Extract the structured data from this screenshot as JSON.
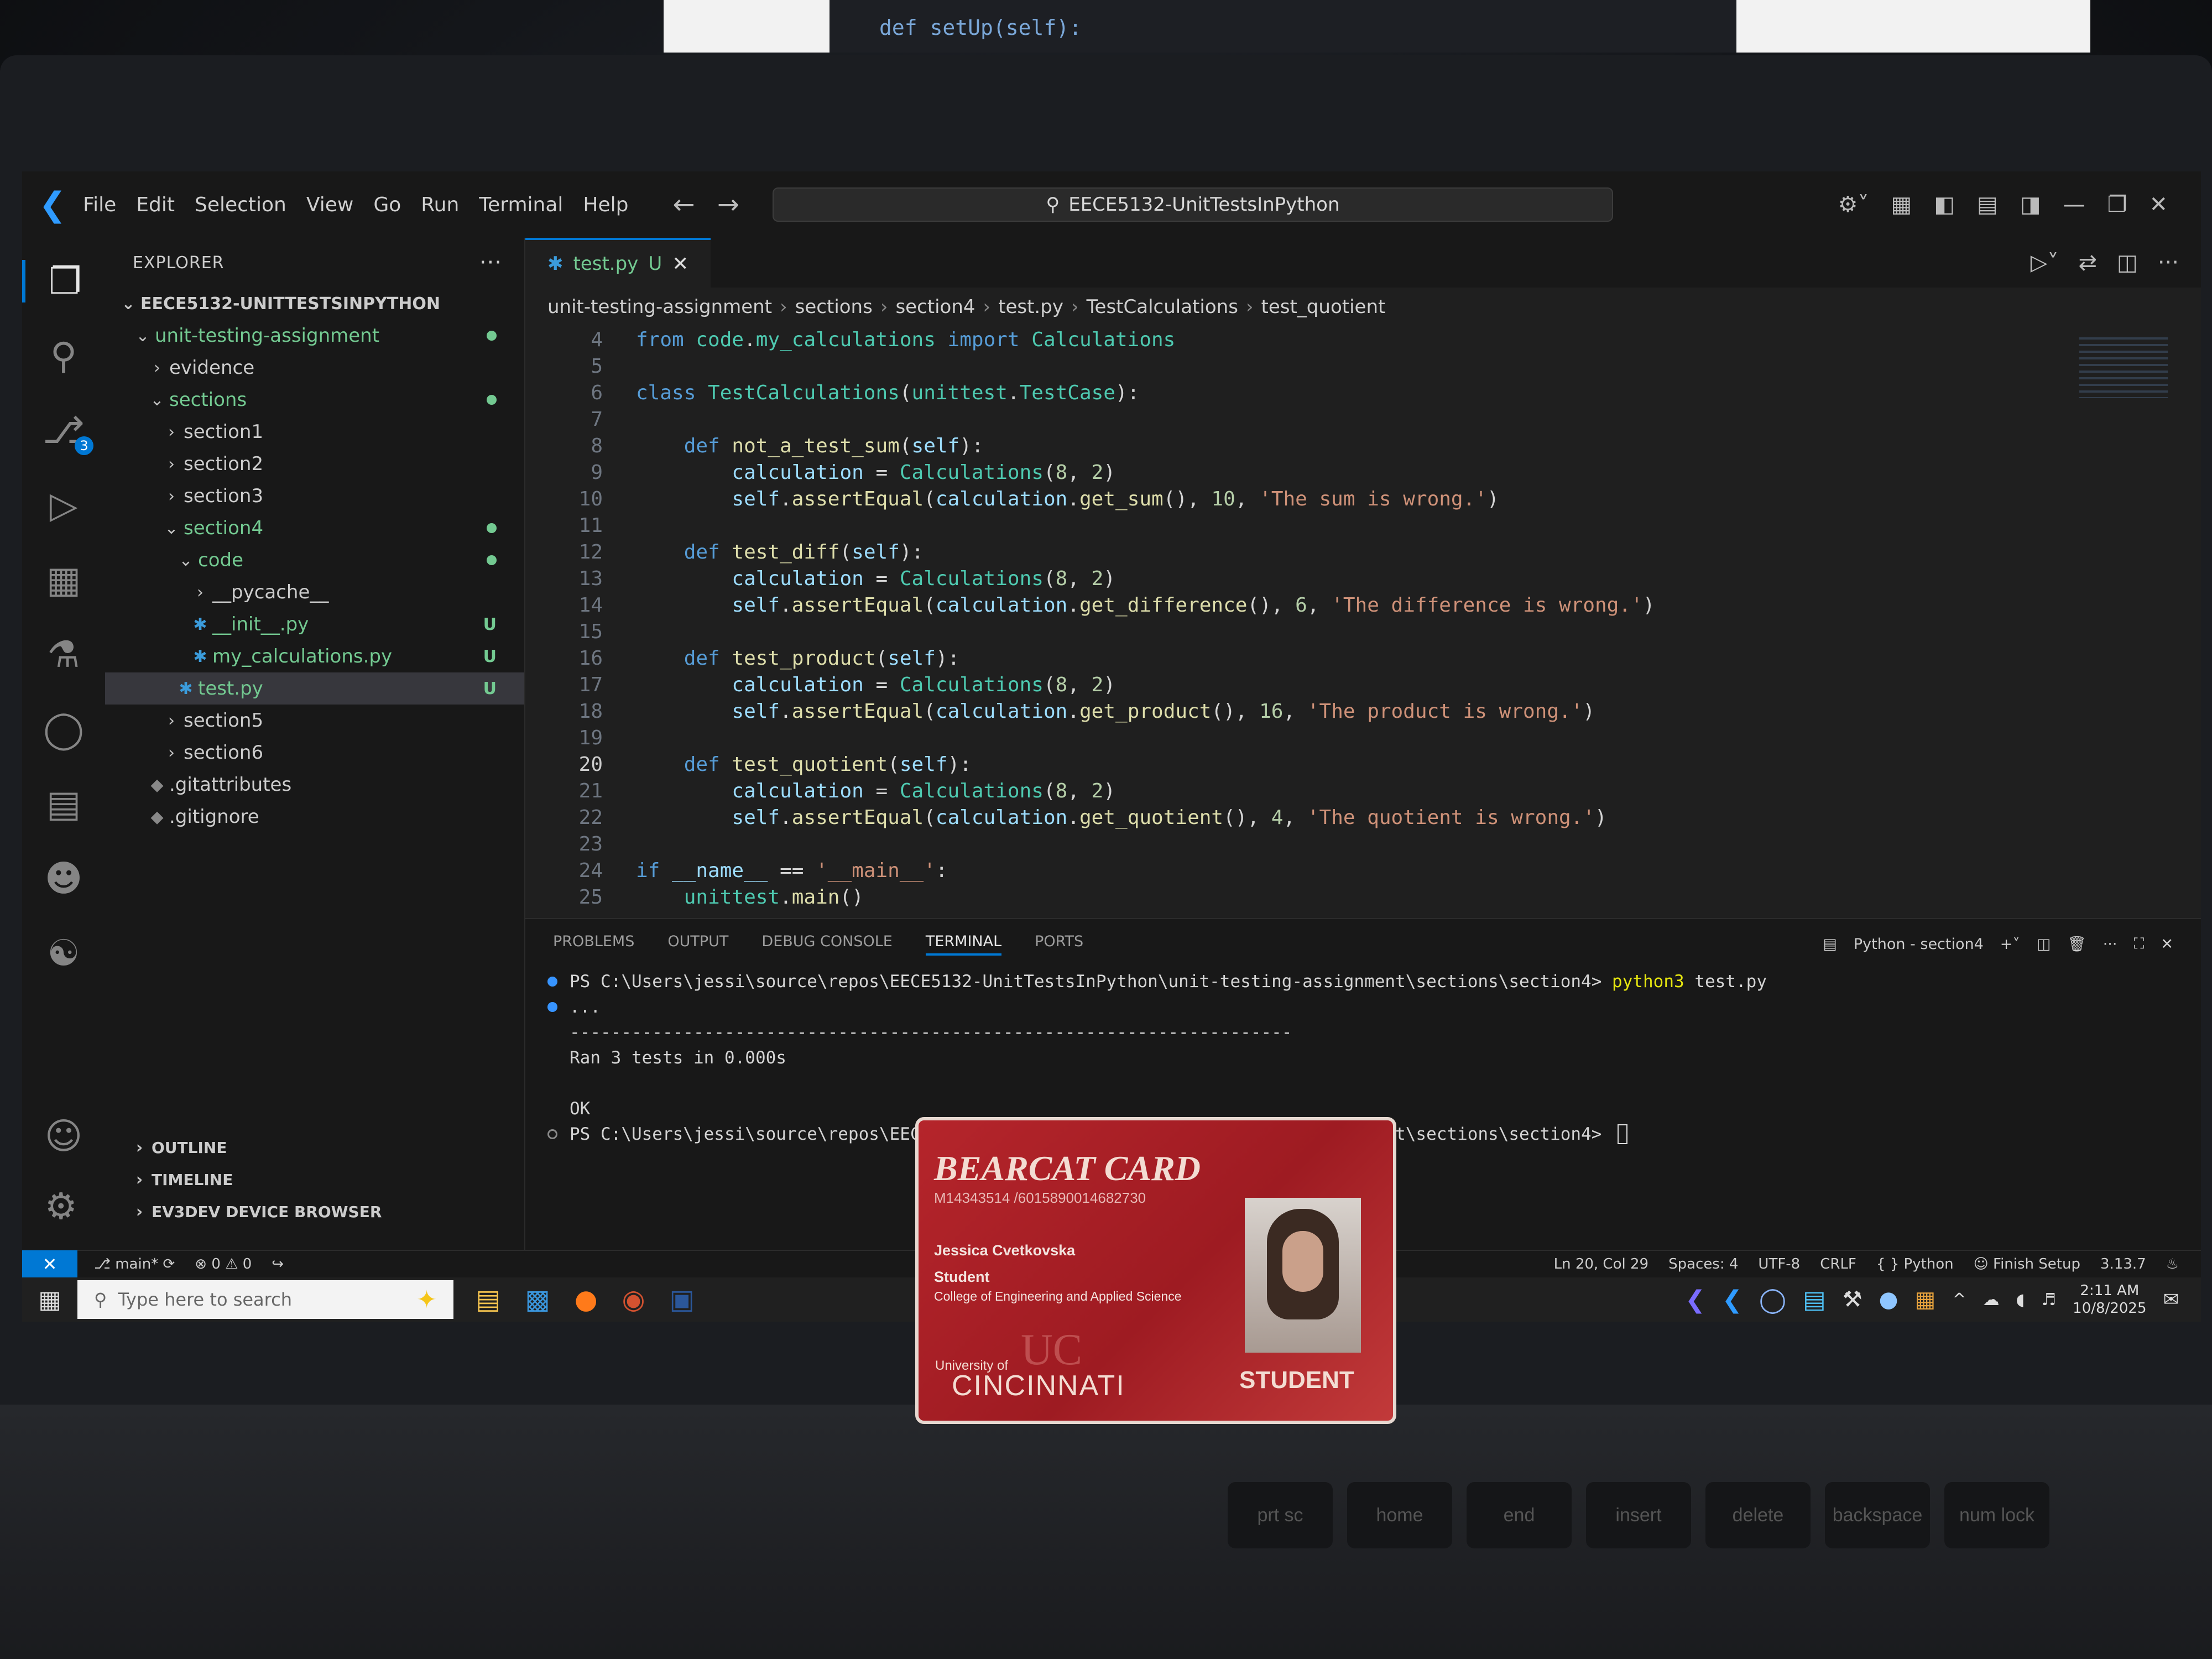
{
  "background_monitor": {
    "code": "def setUp(self):"
  },
  "titlebar": {
    "menu": [
      "File",
      "Edit",
      "Selection",
      "View",
      "Go",
      "Run",
      "Terminal",
      "Help"
    ],
    "search": "EECE5132-UnitTestsInPython"
  },
  "activity_bar": {
    "source_control_badge": "3"
  },
  "explorer": {
    "header": "EXPLORER",
    "root": "EECE5132-UNITTESTSINPYTHON",
    "items": [
      {
        "label": "unit-testing-assignment",
        "depth": 1,
        "chev": "v",
        "status": "dot",
        "green": true
      },
      {
        "label": "evidence",
        "depth": 2,
        "chev": ">",
        "status": "",
        "green": false
      },
      {
        "label": "sections",
        "depth": 2,
        "chev": "v",
        "status": "dot",
        "green": true
      },
      {
        "label": "section1",
        "depth": 3,
        "chev": ">",
        "status": "",
        "green": false
      },
      {
        "label": "section2",
        "depth": 3,
        "chev": ">",
        "status": "",
        "green": false
      },
      {
        "label": "section3",
        "depth": 3,
        "chev": ">",
        "status": "",
        "green": false
      },
      {
        "label": "section4",
        "depth": 3,
        "chev": "v",
        "status": "dot",
        "green": true
      },
      {
        "label": "code",
        "depth": 4,
        "chev": "v",
        "status": "dot",
        "green": true
      },
      {
        "label": "__pycache__",
        "depth": 5,
        "chev": ">",
        "status": "",
        "green": false
      },
      {
        "label": "__init__.py",
        "depth": 5,
        "chev": "py",
        "status": "U",
        "green": true
      },
      {
        "label": "my_calculations.py",
        "depth": 5,
        "chev": "py",
        "status": "U",
        "green": true
      },
      {
        "label": "test.py",
        "depth": 4,
        "chev": "py",
        "status": "U",
        "green": true,
        "selected": true
      },
      {
        "label": "section5",
        "depth": 3,
        "chev": ">",
        "status": "",
        "green": false
      },
      {
        "label": "section6",
        "depth": 3,
        "chev": ">",
        "status": "",
        "green": false
      },
      {
        "label": ".gitattributes",
        "depth": 2,
        "chev": "git",
        "status": "",
        "green": false
      },
      {
        "label": ".gitignore",
        "depth": 2,
        "chev": "git",
        "status": "",
        "green": false
      }
    ],
    "bottom_sections": [
      "OUTLINE",
      "TIMELINE",
      "EV3DEV DEVICE BROWSER"
    ]
  },
  "editor": {
    "tab_label": "test.py",
    "tab_status": "U",
    "breadcrumb": [
      "unit-testing-assignment",
      "sections",
      "section4",
      "test.py",
      "TestCalculations",
      "test_quotient"
    ],
    "current_line": 20,
    "lines": [
      {
        "n": 4,
        "tokens": [
          [
            "kw",
            "from "
          ],
          [
            "cls",
            "code"
          ],
          [
            "plain",
            "."
          ],
          [
            "cls",
            "my_calculations"
          ],
          [
            "kw",
            " import "
          ],
          [
            "cls",
            "Calculations"
          ]
        ]
      },
      {
        "n": 5,
        "tokens": []
      },
      {
        "n": 6,
        "tokens": [
          [
            "kw",
            "class "
          ],
          [
            "cls",
            "TestCalculations"
          ],
          [
            "plain",
            "("
          ],
          [
            "cls",
            "unittest"
          ],
          [
            "plain",
            "."
          ],
          [
            "cls",
            "TestCase"
          ],
          [
            "plain",
            "):"
          ]
        ]
      },
      {
        "n": 7,
        "tokens": []
      },
      {
        "n": 8,
        "tokens": [
          [
            "plain",
            "    "
          ],
          [
            "kw",
            "def "
          ],
          [
            "fn",
            "not_a_test_sum"
          ],
          [
            "plain",
            "("
          ],
          [
            "var",
            "self"
          ],
          [
            "plain",
            "):"
          ]
        ]
      },
      {
        "n": 9,
        "tokens": [
          [
            "plain",
            "        "
          ],
          [
            "var",
            "calculation"
          ],
          [
            "plain",
            " = "
          ],
          [
            "cls",
            "Calculations"
          ],
          [
            "plain",
            "("
          ],
          [
            "num",
            "8"
          ],
          [
            "plain",
            ", "
          ],
          [
            "num",
            "2"
          ],
          [
            "plain",
            ")"
          ]
        ]
      },
      {
        "n": 10,
        "tokens": [
          [
            "plain",
            "        "
          ],
          [
            "var",
            "self"
          ],
          [
            "plain",
            "."
          ],
          [
            "fn",
            "assertEqual"
          ],
          [
            "plain",
            "("
          ],
          [
            "var",
            "calculation"
          ],
          [
            "plain",
            "."
          ],
          [
            "fn",
            "get_sum"
          ],
          [
            "plain",
            "(), "
          ],
          [
            "num",
            "10"
          ],
          [
            "plain",
            ", "
          ],
          [
            "str",
            "'The sum is wrong.'"
          ],
          [
            "plain",
            ")"
          ]
        ]
      },
      {
        "n": 11,
        "tokens": []
      },
      {
        "n": 12,
        "tokens": [
          [
            "plain",
            "    "
          ],
          [
            "kw",
            "def "
          ],
          [
            "fn",
            "test_diff"
          ],
          [
            "plain",
            "("
          ],
          [
            "var",
            "self"
          ],
          [
            "plain",
            "):"
          ]
        ]
      },
      {
        "n": 13,
        "tokens": [
          [
            "plain",
            "        "
          ],
          [
            "var",
            "calculation"
          ],
          [
            "plain",
            " = "
          ],
          [
            "cls",
            "Calculations"
          ],
          [
            "plain",
            "("
          ],
          [
            "num",
            "8"
          ],
          [
            "plain",
            ", "
          ],
          [
            "num",
            "2"
          ],
          [
            "plain",
            ")"
          ]
        ]
      },
      {
        "n": 14,
        "tokens": [
          [
            "plain",
            "        "
          ],
          [
            "var",
            "self"
          ],
          [
            "plain",
            "."
          ],
          [
            "fn",
            "assertEqual"
          ],
          [
            "plain",
            "("
          ],
          [
            "var",
            "calculation"
          ],
          [
            "plain",
            "."
          ],
          [
            "fn",
            "get_difference"
          ],
          [
            "plain",
            "(), "
          ],
          [
            "num",
            "6"
          ],
          [
            "plain",
            ", "
          ],
          [
            "str",
            "'The difference is wrong.'"
          ],
          [
            "plain",
            ")"
          ]
        ]
      },
      {
        "n": 15,
        "tokens": []
      },
      {
        "n": 16,
        "tokens": [
          [
            "plain",
            "    "
          ],
          [
            "kw",
            "def "
          ],
          [
            "fn",
            "test_product"
          ],
          [
            "plain",
            "("
          ],
          [
            "var",
            "self"
          ],
          [
            "plain",
            "):"
          ]
        ]
      },
      {
        "n": 17,
        "tokens": [
          [
            "plain",
            "        "
          ],
          [
            "var",
            "calculation"
          ],
          [
            "plain",
            " = "
          ],
          [
            "cls",
            "Calculations"
          ],
          [
            "plain",
            "("
          ],
          [
            "num",
            "8"
          ],
          [
            "plain",
            ", "
          ],
          [
            "num",
            "2"
          ],
          [
            "plain",
            ")"
          ]
        ]
      },
      {
        "n": 18,
        "tokens": [
          [
            "plain",
            "        "
          ],
          [
            "var",
            "self"
          ],
          [
            "plain",
            "."
          ],
          [
            "fn",
            "assertEqual"
          ],
          [
            "plain",
            "("
          ],
          [
            "var",
            "calculation"
          ],
          [
            "plain",
            "."
          ],
          [
            "fn",
            "get_product"
          ],
          [
            "plain",
            "(), "
          ],
          [
            "num",
            "16"
          ],
          [
            "plain",
            ", "
          ],
          [
            "str",
            "'The product is wrong.'"
          ],
          [
            "plain",
            ")"
          ]
        ]
      },
      {
        "n": 19,
        "tokens": []
      },
      {
        "n": 20,
        "tokens": [
          [
            "plain",
            "    "
          ],
          [
            "kw",
            "def "
          ],
          [
            "fn",
            "test_quotient"
          ],
          [
            "plain",
            "("
          ],
          [
            "var",
            "self"
          ],
          [
            "plain",
            "):"
          ]
        ]
      },
      {
        "n": 21,
        "tokens": [
          [
            "plain",
            "        "
          ],
          [
            "var",
            "calculation"
          ],
          [
            "plain",
            " = "
          ],
          [
            "cls",
            "Calculations"
          ],
          [
            "plain",
            "("
          ],
          [
            "num",
            "8"
          ],
          [
            "plain",
            ", "
          ],
          [
            "num",
            "2"
          ],
          [
            "plain",
            ")"
          ]
        ]
      },
      {
        "n": 22,
        "tokens": [
          [
            "plain",
            "        "
          ],
          [
            "var",
            "self"
          ],
          [
            "plain",
            "."
          ],
          [
            "fn",
            "assertEqual"
          ],
          [
            "plain",
            "("
          ],
          [
            "var",
            "calculation"
          ],
          [
            "plain",
            "."
          ],
          [
            "fn",
            "get_quotient"
          ],
          [
            "plain",
            "(), "
          ],
          [
            "num",
            "4"
          ],
          [
            "plain",
            ", "
          ],
          [
            "str",
            "'The quotient is wrong.'"
          ],
          [
            "plain",
            ")"
          ]
        ]
      },
      {
        "n": 23,
        "tokens": []
      },
      {
        "n": 24,
        "tokens": [
          [
            "kw",
            "if "
          ],
          [
            "var",
            "__name__"
          ],
          [
            "plain",
            " == "
          ],
          [
            "str",
            "'__main__'"
          ],
          [
            "plain",
            ":"
          ]
        ]
      },
      {
        "n": 25,
        "tokens": [
          [
            "plain",
            "    "
          ],
          [
            "cls",
            "unittest"
          ],
          [
            "plain",
            "."
          ],
          [
            "fn",
            "main"
          ],
          [
            "plain",
            "()"
          ]
        ]
      }
    ]
  },
  "panel": {
    "tabs": [
      "PROBLEMS",
      "OUTPUT",
      "DEBUG CONSOLE",
      "TERMINAL",
      "PORTS"
    ],
    "active_tab": "TERMINAL",
    "terminal_name": "Python - section4",
    "terminal": {
      "prompt1": "PS C:\\Users\\jessi\\source\\repos\\EECE5132-UnitTestsInPython\\unit-testing-assignment\\sections\\section4> ",
      "cmd_exe": "python3",
      "cmd_arg": " test.py",
      "dots": "...",
      "rule": "----------------------------------------------------------------------",
      "ran": "Ran 3 tests in 0.000s",
      "ok": "OK",
      "prompt2": "PS C:\\Users\\jessi\\source\\repos\\EECE5132-UnitTestsInPython\\unit-testing-assignment\\sections\\section4> "
    }
  },
  "statusbar": {
    "branch": "main*",
    "errors": "0",
    "warnings": "0",
    "position": "Ln 20, Col 29",
    "spaces": "Spaces: 4",
    "encoding": "UTF-8",
    "eol": "CRLF",
    "language": "Python",
    "finish_setup": "Finish Setup",
    "version": "3.13.7"
  },
  "taskbar": {
    "search_placeholder": "Type here to search",
    "time": "2:11 AM",
    "date": "10/8/2025"
  },
  "id_card": {
    "brand": "BEARCAT CARD",
    "number": "M14343514 /6015890014682730",
    "name": "Jessica Cvetkovska",
    "role": "Student",
    "college": "College of Engineering and Applied Science",
    "uni_small": "University of",
    "uni_big": "CINCINNATI",
    "badge": "STUDENT"
  },
  "keyboard": {
    "keys": [
      "prt sc",
      "home",
      "end",
      "insert",
      "delete",
      "backspace",
      "num lock"
    ]
  }
}
